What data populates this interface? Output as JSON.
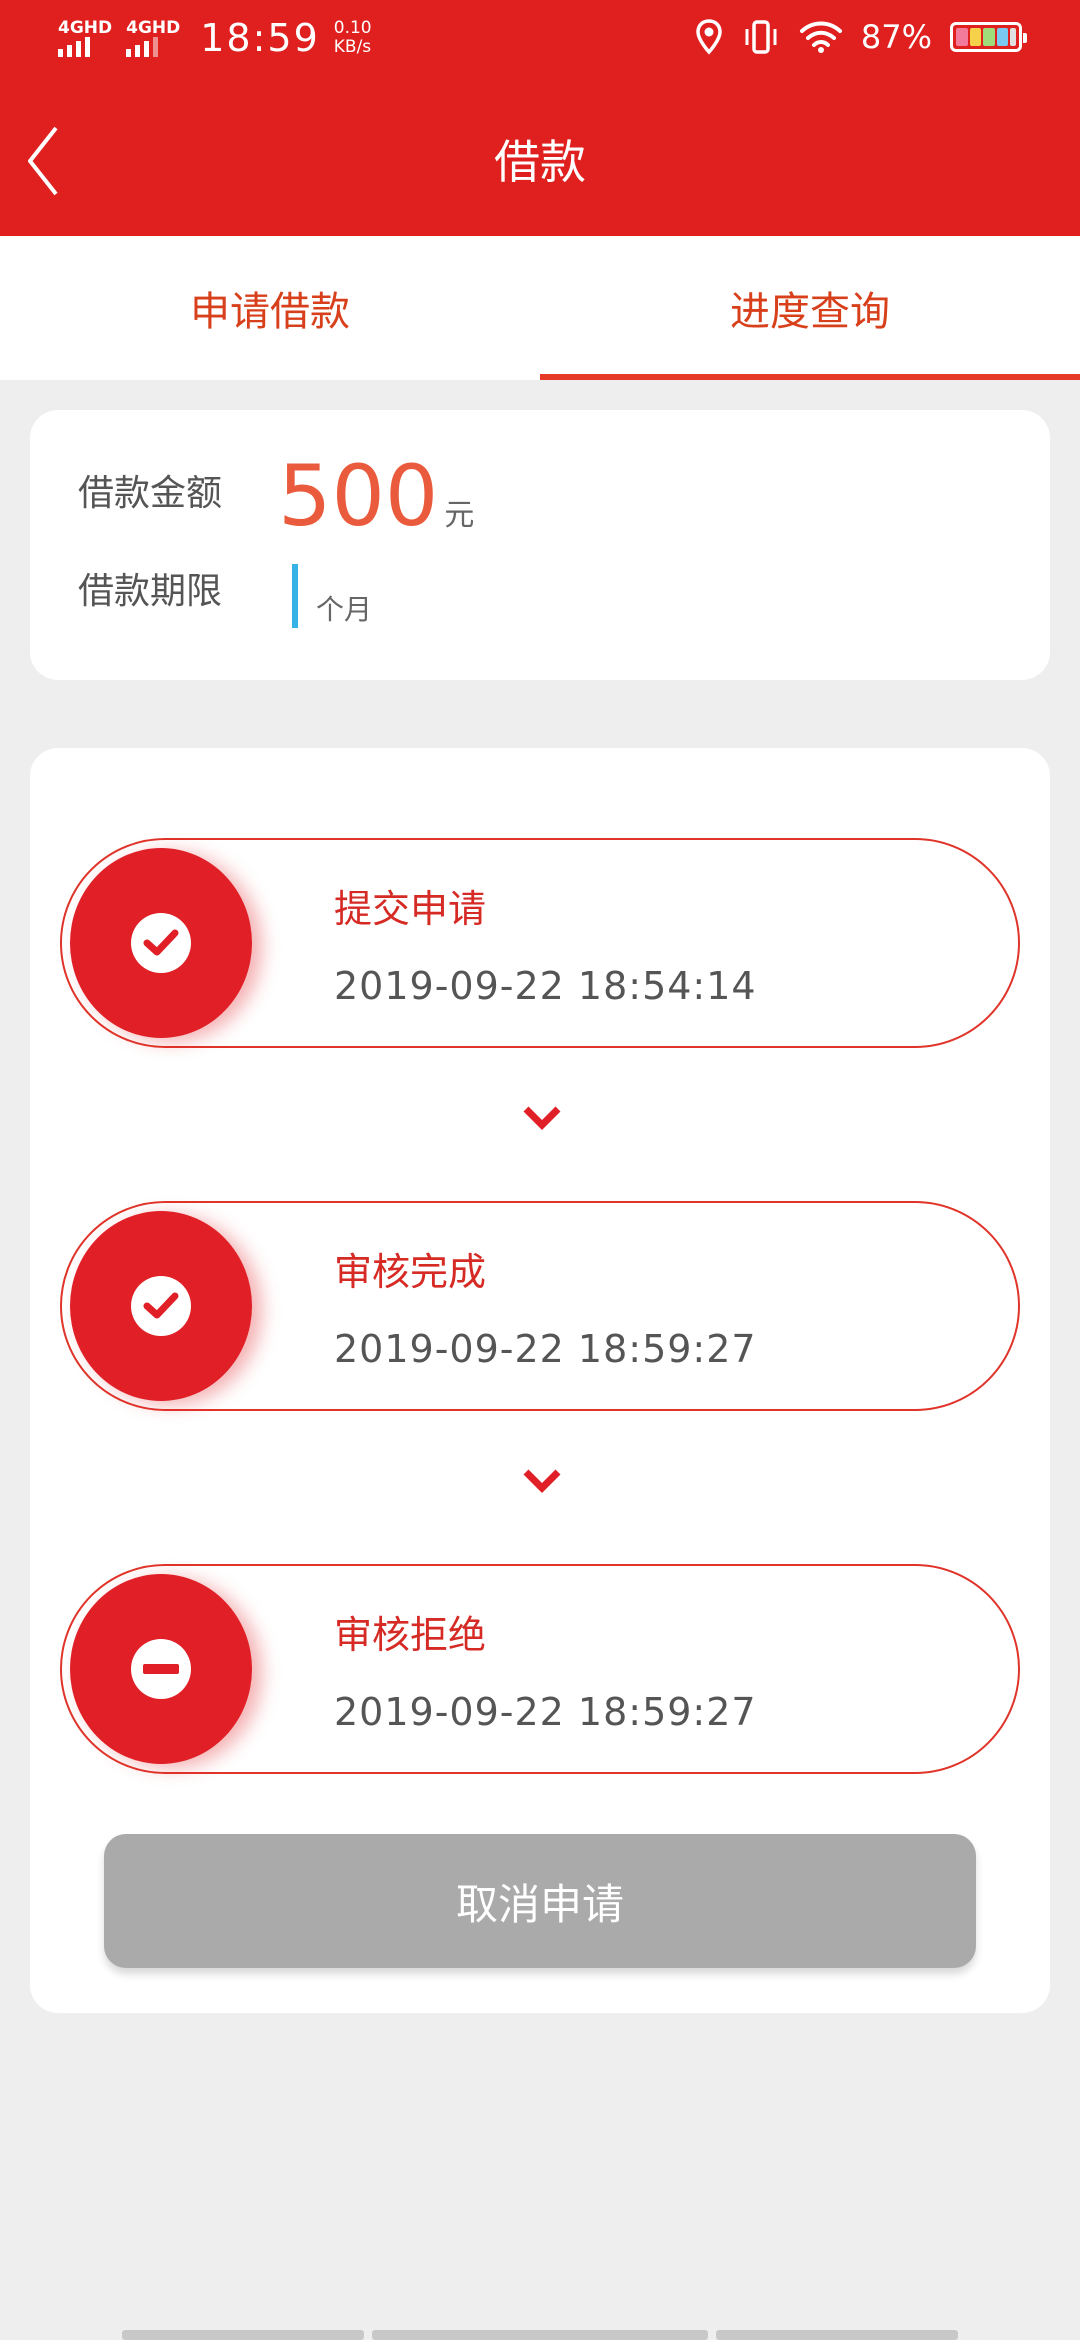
{
  "status_bar": {
    "signal1": "4GHD",
    "signal2": "4GHD",
    "time": "18:59",
    "speed_value": "0.10",
    "speed_unit": "KB/s",
    "battery_percent": "87%"
  },
  "header": {
    "title": "借款"
  },
  "tabs": [
    {
      "label": "申请借款",
      "active": false
    },
    {
      "label": "进度查询",
      "active": true
    }
  ],
  "loan": {
    "amount_label": "借款金额",
    "amount_value": "500",
    "amount_unit": "元",
    "term_label": "借款期限",
    "term_unit": "个月"
  },
  "steps": [
    {
      "title": "提交申请",
      "time": "2019-09-22 18:54:14",
      "icon": "check-icon"
    },
    {
      "title": "审核完成",
      "time": "2019-09-22 18:59:27",
      "icon": "check-icon"
    },
    {
      "title": "审核拒绝",
      "time": "2019-09-22 18:59:27",
      "icon": "minus-icon"
    }
  ],
  "cancel_button": "取消申请",
  "colors": {
    "brand_red": "#e01f1f",
    "tab_text": "#d8401c",
    "amount": "#ea5b3d",
    "cursor": "#36b3e6",
    "disabled_button": "#aaaaaa"
  }
}
